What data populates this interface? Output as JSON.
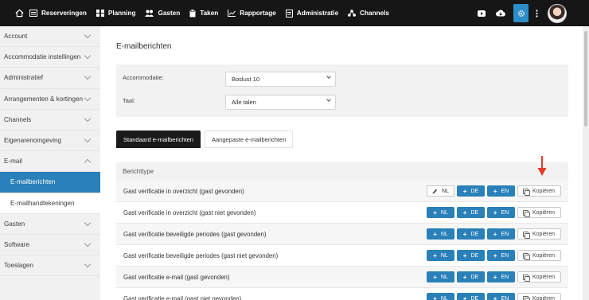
{
  "nav": {
    "items": [
      {
        "label": "Reserveringen",
        "icon": "calendar-list-icon"
      },
      {
        "label": "Planning",
        "icon": "grid-icon"
      },
      {
        "label": "Gasten",
        "icon": "users-icon"
      },
      {
        "label": "Taken",
        "icon": "clipboard-icon"
      },
      {
        "label": "Rapportage",
        "icon": "chart-icon"
      },
      {
        "label": "Administratie",
        "icon": "document-icon"
      },
      {
        "label": "Channels",
        "icon": "network-icon"
      }
    ]
  },
  "sidebar": {
    "items": [
      {
        "label": "Account"
      },
      {
        "label": "Accommodatie instellingen"
      },
      {
        "label": "Administratief"
      },
      {
        "label": "Arrangementen & kortingen"
      },
      {
        "label": "Channels"
      },
      {
        "label": "Eigenarenomgeving"
      },
      {
        "label": "E-mail"
      },
      {
        "label": "E-mailberichten"
      },
      {
        "label": "E-mailhandtekeningen"
      },
      {
        "label": "Gasten"
      },
      {
        "label": "Software"
      },
      {
        "label": "Toeslagen"
      }
    ]
  },
  "main": {
    "title": "E-mailberichten",
    "settings": {
      "accommodation_label": "Accommodatie:",
      "accommodation_value": "Boslust 10",
      "language_label": "Taal:",
      "language_value": "Alle talen"
    },
    "tabs": [
      {
        "label": "Standaard e-mailberichten"
      },
      {
        "label": "Aangepaste e-mailberichten"
      }
    ],
    "table": {
      "header": "Berichttype",
      "rows": [
        {
          "label": "Gast verificatie in overzicht (gast gevonden)",
          "b1": "NL",
          "b2": "DE",
          "b3": "EN",
          "copy": "Kopiëren"
        },
        {
          "label": "Gast verificatie in overzicht (gast niet gevonden)",
          "b1": "NL",
          "b2": "DE",
          "b3": "EN",
          "copy": "Kopiëren"
        },
        {
          "label": "Gast verificatie beveiligde periodes (gast gevonden)",
          "b1": "NL",
          "b2": "DE",
          "b3": "EN",
          "copy": "Kopiëren"
        },
        {
          "label": "Gast verificatie beveiligde periodes (gast niet gevonden)",
          "b1": "NL",
          "b2": "DE",
          "b3": "EN",
          "copy": "Kopiëren"
        },
        {
          "label": "Gast verificatie e-mail (gast gevonden)",
          "b1": "NL",
          "b2": "DE",
          "b3": "EN",
          "copy": "Kopiëren"
        },
        {
          "label": "Gast verificatie e-mail (gast niet gevonden)",
          "b1": "NL",
          "b2": "DE",
          "b3": "EN",
          "copy": "Kopiëren"
        }
      ]
    }
  },
  "colors": {
    "accent": "#2a80b9",
    "topbar": "#161616",
    "annotation_arrow": "#e53b2c"
  }
}
